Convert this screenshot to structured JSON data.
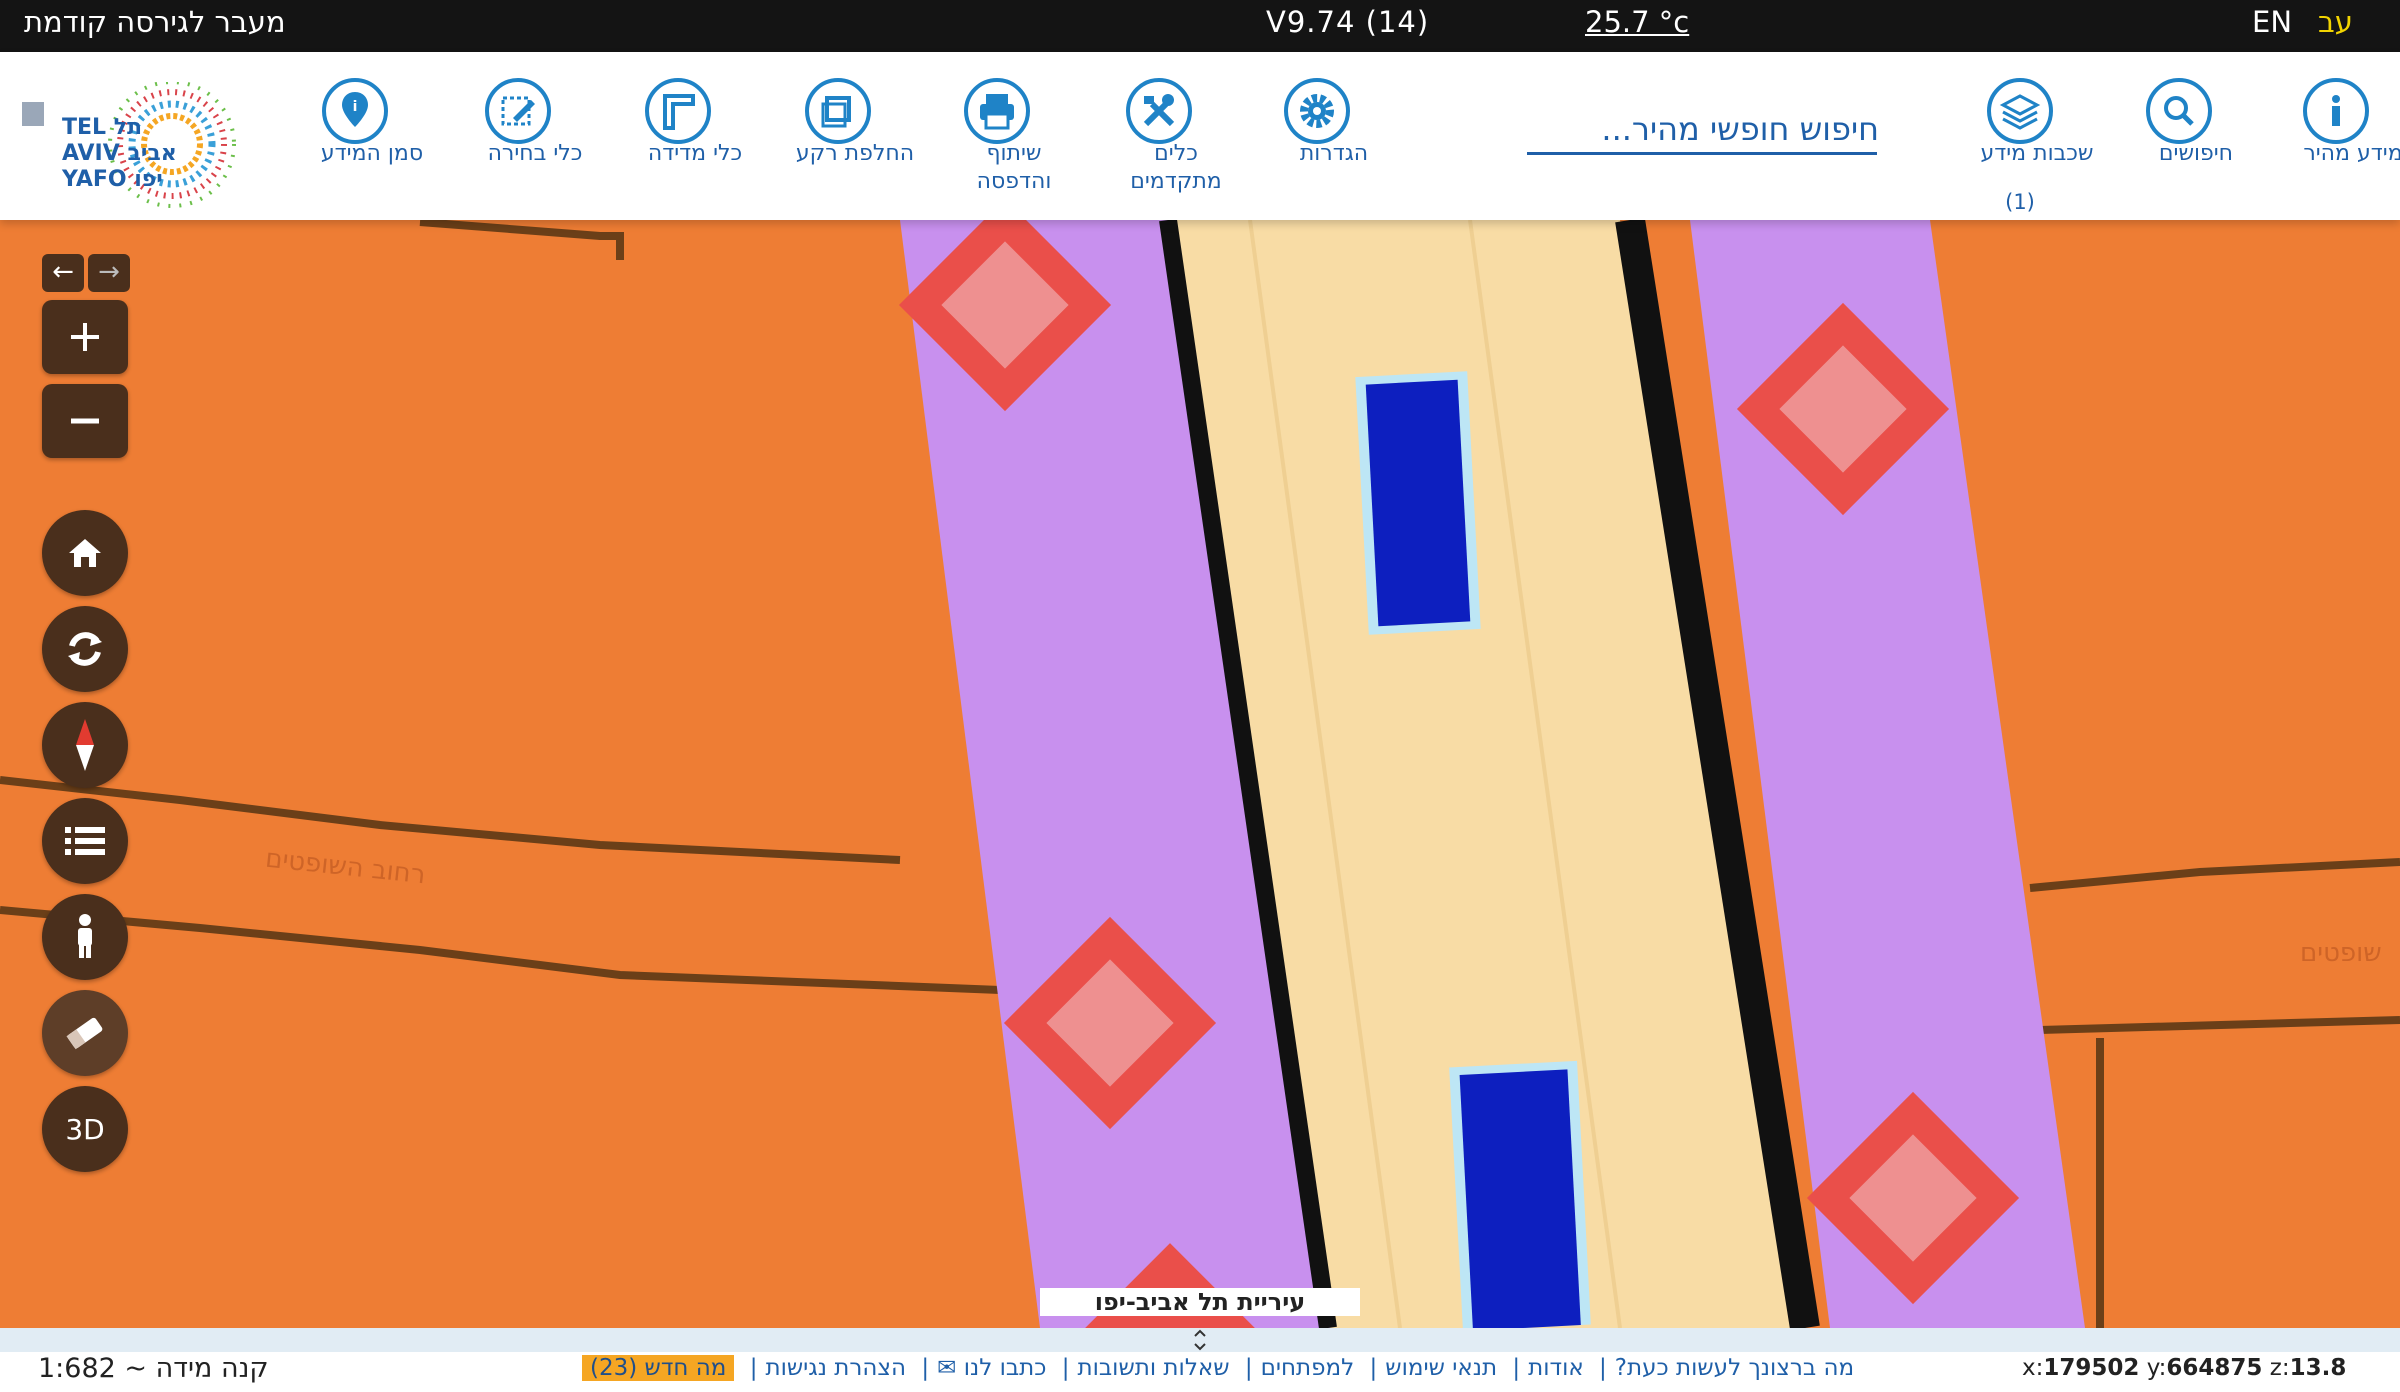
{
  "topbar": {
    "prev_version": "מעבר לגירסה קודמת",
    "version": "V9.74 (14)",
    "temperature": "25.7 °c",
    "lang_en": "EN",
    "lang_he": "עב"
  },
  "toolbar": {
    "quick_info": "מידע מהיר",
    "searches": "חיפושים",
    "layers": "שכבות מידע",
    "layers_count": "(1)",
    "search_placeholder": "חיפוש חופשי מהיר...",
    "settings": "הגדרות",
    "advanced_tools": [
      "כלים",
      "מתקדמים"
    ],
    "share_print": [
      "שיתוף",
      "והדפסה"
    ],
    "basemap": "החלפת רקע",
    "measure": "כלי מדידה",
    "select": "כלי בחירה",
    "marker": "סמן המידע",
    "logo_text": [
      "TEL תל",
      "AVIV אביב",
      "YAFO יפו"
    ]
  },
  "map": {
    "city_label": "עיריית תל אביב-יפו",
    "street_1": "רחוב השופטים",
    "street_2": "שופטים",
    "colors": {
      "background": "#ee7d34",
      "road": "#f8dca5",
      "sidewalk": "#c890ee",
      "marker_ring": "#ea4f4a",
      "marker_center": "#ee9090",
      "vehicle": "#0d1fbf"
    }
  },
  "controls": {
    "icons": [
      "arrow-left-icon",
      "arrow-right-icon",
      "zoom-in-icon",
      "zoom-out-icon",
      "home-icon",
      "refresh-icon",
      "compass-icon",
      "list-icon",
      "person-icon",
      "eraser-icon"
    ],
    "three_d": "3D"
  },
  "bottom": {
    "scale": "קנה מידה ~ 1:682",
    "links": [
      "מה ברצונך לעשות כעת?",
      "אודות",
      "תנאי שימוש",
      "למפתחים",
      "שאלות ותשובות",
      "כתבו לנו ✉",
      "הצהרת נגישות"
    ],
    "whats_new": "מה חדש (23)",
    "coord_x_label": "x:",
    "coord_x": "179502",
    "coord_y_label": "y:",
    "coord_y": "664875",
    "coord_z_label": "z:",
    "coord_z": "13.8"
  }
}
